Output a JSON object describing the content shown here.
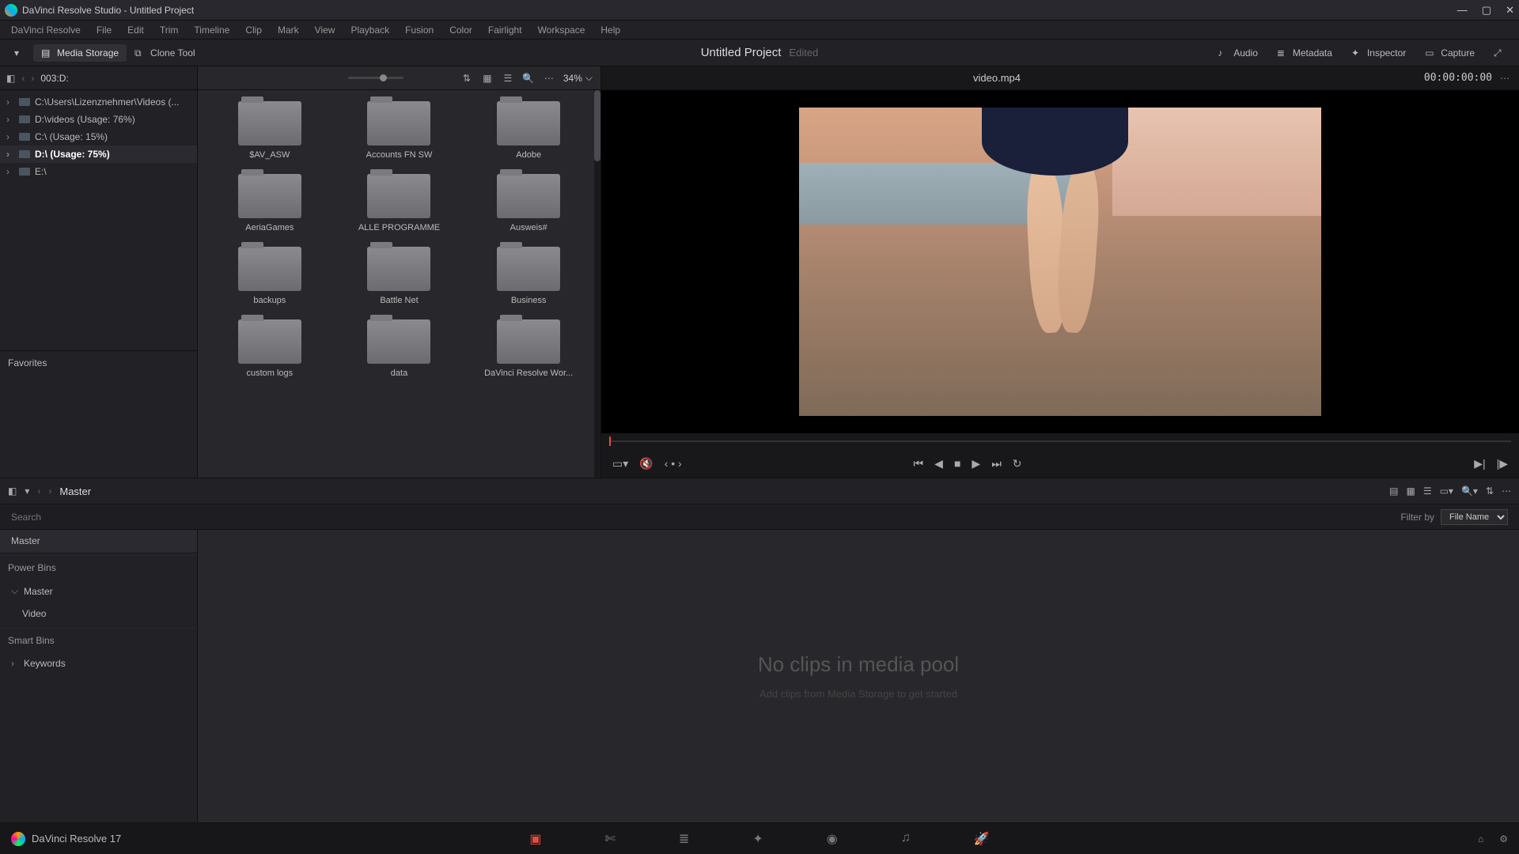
{
  "window": {
    "title": "DaVinci Resolve Studio - Untitled Project"
  },
  "menu": [
    "DaVinci Resolve",
    "File",
    "Edit",
    "Trim",
    "Timeline",
    "Clip",
    "Mark",
    "View",
    "Playback",
    "Fusion",
    "Color",
    "Fairlight",
    "Workspace",
    "Help"
  ],
  "toolbar": {
    "media_storage": "Media Storage",
    "clone_tool": "Clone Tool",
    "project_title": "Untitled Project",
    "edited": "Edited",
    "audio": "Audio",
    "metadata": "Metadata",
    "inspector": "Inspector",
    "capture": "Capture"
  },
  "storage": {
    "path": "003:D:",
    "drives": [
      {
        "label": "C:\\Users\\Lizenznehmer\\Videos (...",
        "selected": false
      },
      {
        "label": "D:\\videos (Usage: 76%)",
        "selected": false
      },
      {
        "label": "C:\\ (Usage: 15%)",
        "selected": false
      },
      {
        "label": "D:\\ (Usage: 75%)",
        "selected": true
      },
      {
        "label": "E:\\",
        "selected": false
      }
    ],
    "favorites_label": "Favorites"
  },
  "browser": {
    "zoom": "34%",
    "folders": [
      "$AV_ASW",
      "Accounts FN SW",
      "Adobe",
      "AeriaGames",
      "ALLE PROGRAMME",
      "Ausweis#",
      "backups",
      "Battle Net",
      "Business",
      "custom logs",
      "data",
      "DaVinci Resolve Wor..."
    ]
  },
  "viewer": {
    "filename": "video.mp4",
    "timecode": "00:00:00:00"
  },
  "pool": {
    "breadcrumb": "Master",
    "search_placeholder": "Search",
    "filter_label": "Filter by",
    "filter_value": "File Name",
    "tree": {
      "master": "Master",
      "powerbins": "Power Bins",
      "pb_master": "Master",
      "pb_video": "Video",
      "smartbins": "Smart Bins",
      "keywords": "Keywords"
    },
    "empty_title": "No clips in media pool",
    "empty_hint": "Add clips from Media Storage to get started"
  },
  "footer": {
    "brand": "DaVinci Resolve 17"
  }
}
